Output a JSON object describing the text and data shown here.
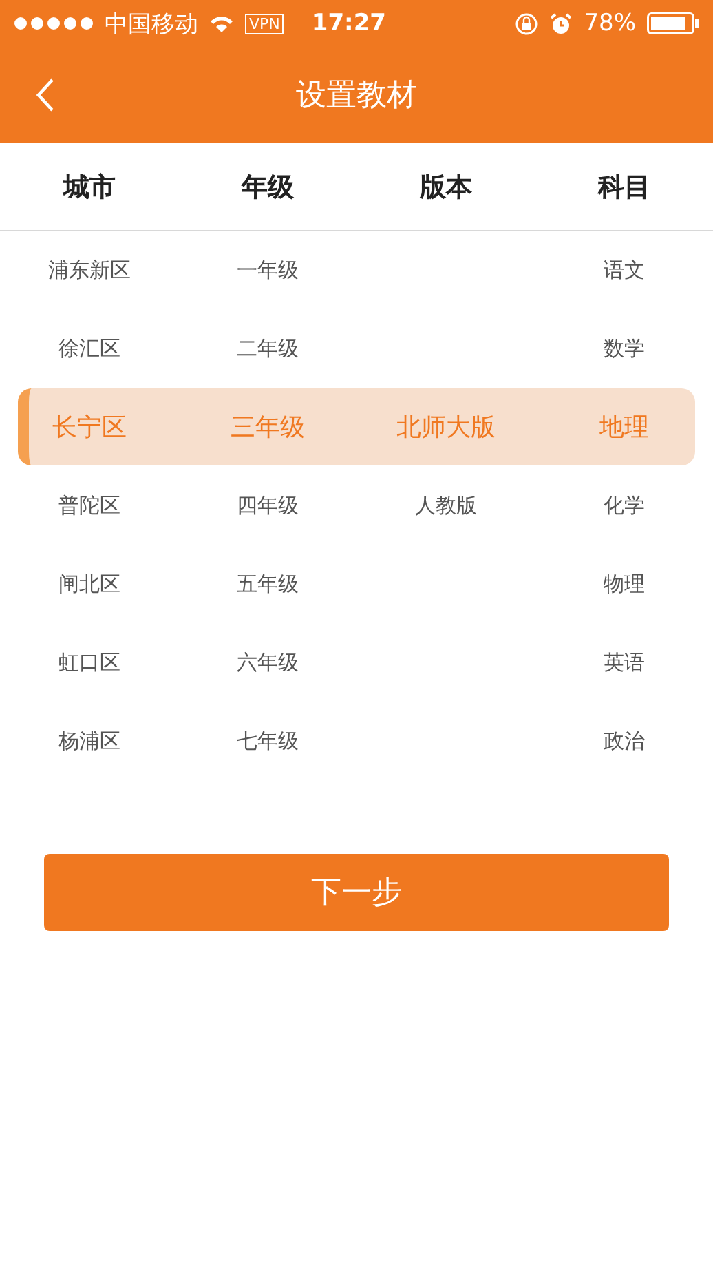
{
  "status_bar": {
    "carrier": "中国移动",
    "vpn": "VPN",
    "time": "17:27",
    "battery": "78%"
  },
  "nav": {
    "title": "设置教材"
  },
  "columns": [
    {
      "heading": "城市",
      "items": [
        {
          "label": "浦东新区",
          "selected": false
        },
        {
          "label": "徐汇区",
          "selected": false
        },
        {
          "label": "长宁区",
          "selected": true
        },
        {
          "label": "普陀区",
          "selected": false
        },
        {
          "label": "闸北区",
          "selected": false
        },
        {
          "label": "虹口区",
          "selected": false
        },
        {
          "label": "杨浦区",
          "selected": false
        }
      ]
    },
    {
      "heading": "年级",
      "items": [
        {
          "label": "一年级",
          "selected": false
        },
        {
          "label": "二年级",
          "selected": false
        },
        {
          "label": "三年级",
          "selected": true
        },
        {
          "label": "四年级",
          "selected": false
        },
        {
          "label": "五年级",
          "selected": false
        },
        {
          "label": "六年级",
          "selected": false
        },
        {
          "label": "七年级",
          "selected": false
        }
      ]
    },
    {
      "heading": "版本",
      "items": [
        {
          "label": "北师大版",
          "selected": true
        },
        {
          "label": "人教版",
          "selected": false
        }
      ]
    },
    {
      "heading": "科目",
      "items": [
        {
          "label": "语文",
          "selected": false
        },
        {
          "label": "数学",
          "selected": false
        },
        {
          "label": "地理",
          "selected": true
        },
        {
          "label": "化学",
          "selected": false
        },
        {
          "label": "物理",
          "selected": false
        },
        {
          "label": "英语",
          "selected": false
        },
        {
          "label": "政治",
          "selected": false
        }
      ]
    }
  ],
  "next_button": "下一步"
}
